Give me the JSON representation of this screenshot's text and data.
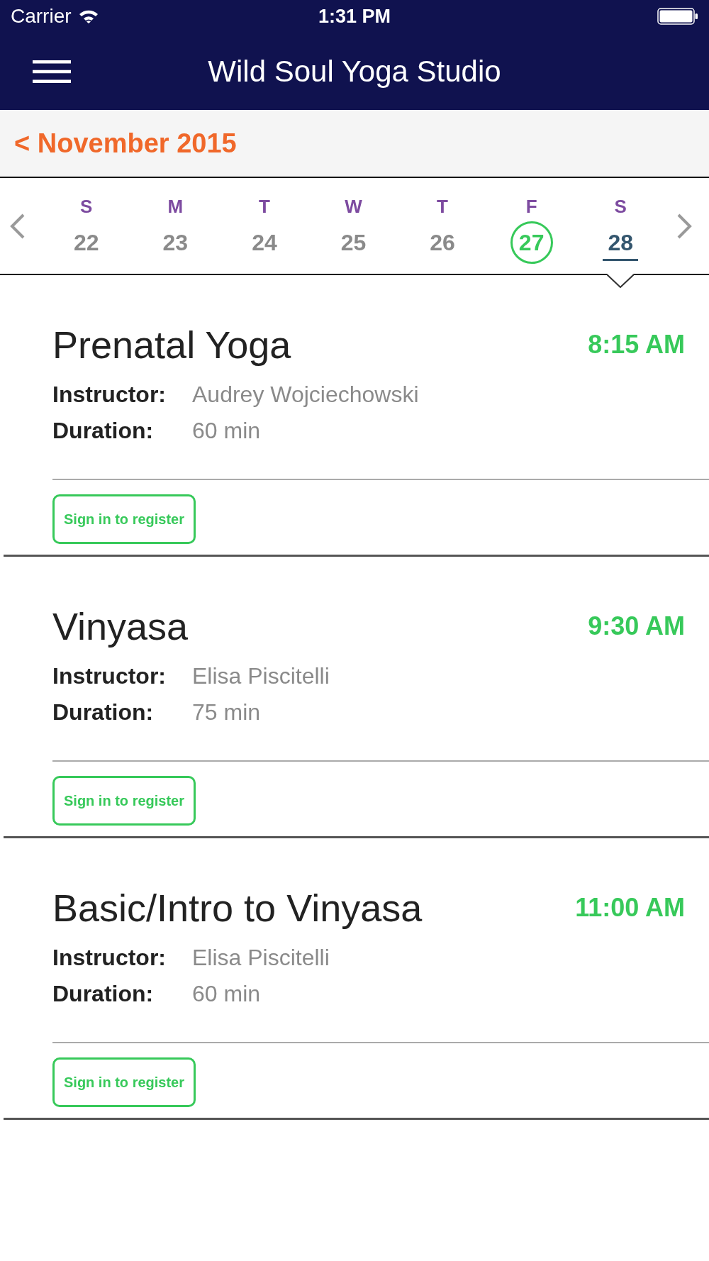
{
  "status_bar": {
    "carrier": "Carrier",
    "time": "1:31 PM"
  },
  "nav_bar": {
    "title": "Wild Soul Yoga Studio"
  },
  "month_nav": {
    "label": "< November 2015"
  },
  "week": {
    "days": [
      {
        "weekday": "S",
        "date": "22",
        "today": false,
        "selected": false
      },
      {
        "weekday": "M",
        "date": "23",
        "today": false,
        "selected": false
      },
      {
        "weekday": "T",
        "date": "24",
        "today": false,
        "selected": false
      },
      {
        "weekday": "W",
        "date": "25",
        "today": false,
        "selected": false
      },
      {
        "weekday": "T",
        "date": "26",
        "today": false,
        "selected": false
      },
      {
        "weekday": "F",
        "date": "27",
        "today": true,
        "selected": false
      },
      {
        "weekday": "S",
        "date": "28",
        "today": false,
        "selected": true
      }
    ]
  },
  "classes": [
    {
      "name": "Prenatal Yoga",
      "time": "8:15 AM",
      "instructor_label": "Instructor:",
      "instructor": "Audrey Wojciechowski",
      "duration_label": "Duration:",
      "duration": "60 min",
      "button": "Sign in to register"
    },
    {
      "name": "Vinyasa",
      "time": "9:30 AM",
      "instructor_label": "Instructor:",
      "instructor": "Elisa Piscitelli",
      "duration_label": "Duration:",
      "duration": "75 min",
      "button": "Sign in to register"
    },
    {
      "name": "Basic/Intro to Vinyasa",
      "time": "11:00 AM",
      "instructor_label": "Instructor:",
      "instructor": "Elisa Piscitelli",
      "duration_label": "Duration:",
      "duration": "60 min",
      "button": "Sign in to register"
    }
  ]
}
